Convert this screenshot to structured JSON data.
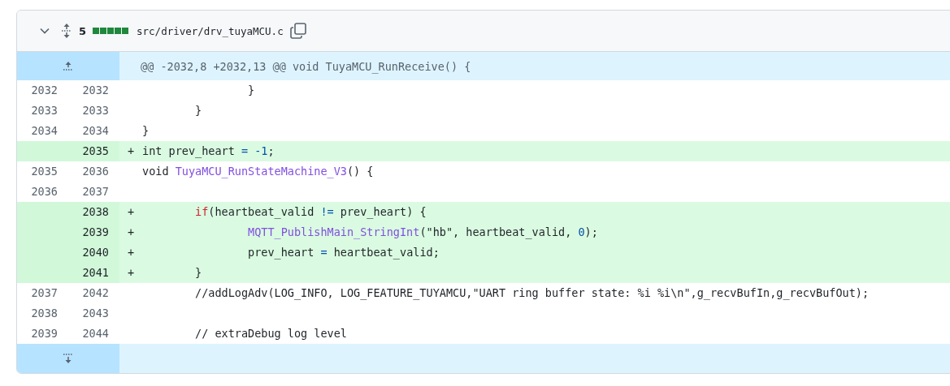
{
  "file_header": {
    "expanded": true,
    "change_count": "5",
    "diffstat": [
      {
        "kind": "added"
      },
      {
        "kind": "added"
      },
      {
        "kind": "added"
      },
      {
        "kind": "added"
      },
      {
        "kind": "added"
      }
    ],
    "path": "src/driver/drv_tuyaMCU.c"
  },
  "hunk_header": "@@ -2032,8 +2032,13 @@ void TuyaMCU_RunReceive() {",
  "lines": [
    {
      "kind": "context",
      "old": "2032",
      "new": "2032",
      "tokens": [
        {
          "kind": "plain",
          "text": "\t\t}"
        }
      ]
    },
    {
      "kind": "context",
      "old": "2033",
      "new": "2033",
      "tokens": [
        {
          "kind": "plain",
          "text": "\t}"
        }
      ]
    },
    {
      "kind": "context",
      "old": "2034",
      "new": "2034",
      "tokens": [
        {
          "kind": "plain",
          "text": "}"
        }
      ]
    },
    {
      "kind": "addition",
      "new": "2035",
      "marker": "+",
      "tokens": [
        {
          "kind": "plain",
          "text": "int prev_heart "
        },
        {
          "kind": "operator",
          "text": "= "
        },
        {
          "kind": "constant",
          "text": "-1"
        },
        {
          "kind": "plain",
          "text": ";"
        }
      ]
    },
    {
      "kind": "context",
      "old": "2035",
      "new": "2036",
      "tokens": [
        {
          "kind": "plain",
          "text": "void "
        },
        {
          "kind": "entity",
          "text": "TuyaMCU_RunStateMachine_V3"
        },
        {
          "kind": "plain",
          "text": "() {"
        }
      ]
    },
    {
      "kind": "context",
      "old": "2036",
      "new": "2037"
    },
    {
      "kind": "addition",
      "new": "2038",
      "marker": "+",
      "tokens": [
        {
          "kind": "keyword",
          "text": "\tif"
        },
        {
          "kind": "plain",
          "text": "(heartbeat_valid "
        },
        {
          "kind": "operator",
          "text": "!="
        },
        {
          "kind": "plain",
          "text": " prev_heart) {"
        }
      ]
    },
    {
      "kind": "addition",
      "new": "2039",
      "marker": "+",
      "tokens": [
        {
          "kind": "entity",
          "text": "\t\tMQTT_PublishMain_StringInt"
        },
        {
          "kind": "plain",
          "text": "(\"hb\", heartbeat_valid, "
        },
        {
          "kind": "constant",
          "text": "0"
        },
        {
          "kind": "plain",
          "text": ");"
        }
      ]
    },
    {
      "kind": "addition",
      "new": "2040",
      "marker": "+",
      "tokens": [
        {
          "kind": "plain",
          "text": "\t\tprev_heart "
        },
        {
          "kind": "operator",
          "text": "="
        },
        {
          "kind": "plain",
          "text": " heartbeat_valid;"
        }
      ]
    },
    {
      "kind": "addition",
      "new": "2041",
      "marker": "+",
      "tokens": [
        {
          "kind": "plain",
          "text": "\t}"
        }
      ]
    },
    {
      "kind": "context",
      "old": "2037",
      "new": "2042",
      "tokens": [
        {
          "kind": "plain",
          "text": "\t//addLogAdv(LOG_INFO, LOG_FEATURE_TUYAMCU,\"UART ring buffer state: %i %i\\n\",g_recvBufIn,g_recvBufOut);"
        }
      ]
    },
    {
      "kind": "context",
      "old": "2038",
      "new": "2043"
    },
    {
      "kind": "context",
      "old": "2039",
      "new": "2044",
      "tokens": [
        {
          "kind": "plain",
          "text": "\t// extraDebug log level"
        }
      ]
    }
  ]
}
